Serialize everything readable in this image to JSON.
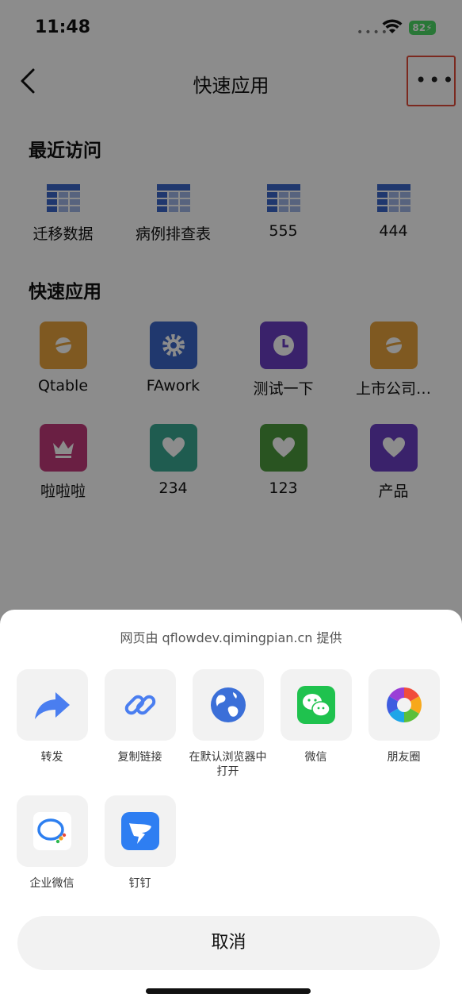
{
  "status": {
    "time": "11:48",
    "battery": "82"
  },
  "nav": {
    "title": "快速应用"
  },
  "recent": {
    "title": "最近访问",
    "items": [
      "迁移数据",
      "病例排查表",
      "555",
      "444"
    ]
  },
  "quick": {
    "title": "快速应用",
    "items": [
      {
        "label": "Qtable",
        "color": "#e8a23c",
        "icon": "planet-icon"
      },
      {
        "label": "FAwork",
        "color": "#3b67c8",
        "icon": "gear-icon"
      },
      {
        "label": "测试一下",
        "color": "#6a3fc4",
        "icon": "clock-icon"
      },
      {
        "label": "上市公司…",
        "color": "#e8a23c",
        "icon": "planet-icon"
      },
      {
        "label": "啦啦啦",
        "color": "#c23a7a",
        "icon": "crown-icon"
      },
      {
        "label": "234",
        "color": "#3aa893",
        "icon": "heart-icon"
      },
      {
        "label": "123",
        "color": "#4c9a3c",
        "icon": "heart-icon"
      },
      {
        "label": "产品",
        "color": "#6a3fc4",
        "icon": "heart-icon"
      }
    ]
  },
  "sheet": {
    "provider": "网页由 qflowdev.qimingpian.cn 提供",
    "row1": [
      "转发",
      "复制链接",
      "在默认浏览器中打开",
      "微信",
      "朋友圈"
    ],
    "row2": [
      "企业微信",
      "钉钉"
    ],
    "cancel": "取消"
  }
}
